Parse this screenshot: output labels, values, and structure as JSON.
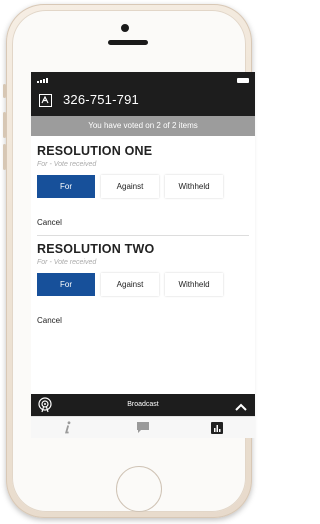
{
  "header": {
    "meeting_id": "326-751-791",
    "voted_banner": "You have voted on 2 of 2 items"
  },
  "resolutions": [
    {
      "title": "RESOLUTION ONE",
      "status": "For - Vote received",
      "options": [
        "For",
        "Against",
        "Withheld"
      ],
      "selected": "For",
      "cancel_label": "Cancel"
    },
    {
      "title": "RESOLUTION TWO",
      "status": "For - Vote received",
      "options": [
        "For",
        "Against",
        "Withheld"
      ],
      "selected": "For",
      "cancel_label": "Cancel"
    }
  ],
  "broadcast": {
    "label": "Broadcast",
    "icon": "broadcast-icon",
    "toggle_icon": "chevron-up-icon"
  },
  "tabs": [
    {
      "icon": "info-icon"
    },
    {
      "icon": "chat-icon"
    },
    {
      "icon": "results-chart-icon"
    }
  ],
  "colors": {
    "accent": "#17509a",
    "banner": "#9c9c9c",
    "bar": "#1d1d1d"
  }
}
